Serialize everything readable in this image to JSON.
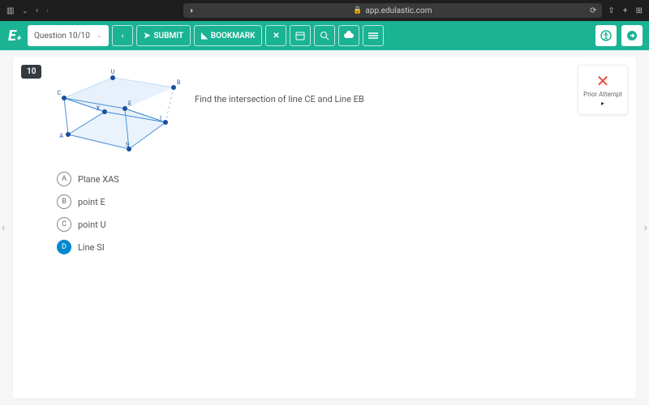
{
  "browser": {
    "url": "app.edulastic.com"
  },
  "toolbar": {
    "question_select": "Question 10/10",
    "submit": "SUBMIT",
    "bookmark": "BOOKMARK"
  },
  "question": {
    "number": "10",
    "prompt": "Find the intersection of line CE and Line EB",
    "diagram_labels": {
      "U": "U",
      "B": "B",
      "C": "C",
      "E": "E",
      "X": "X",
      "I": "I",
      "A": "A",
      "S": "S"
    }
  },
  "choices": [
    {
      "letter": "A",
      "text": "Plane XAS",
      "selected": false
    },
    {
      "letter": "B",
      "text": "point E",
      "selected": false
    },
    {
      "letter": "C",
      "text": "point U",
      "selected": false
    },
    {
      "letter": "D",
      "text": "Line SI",
      "selected": true
    }
  ],
  "prior": {
    "label": "Prior Attempt"
  }
}
